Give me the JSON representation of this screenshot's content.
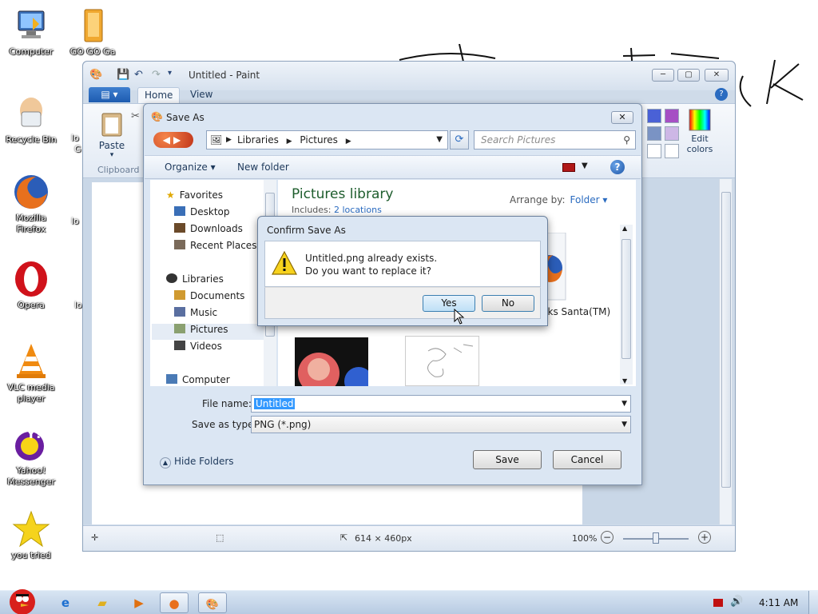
{
  "desktop": {
    "icons": [
      {
        "label": "Computer"
      },
      {
        "label": "GO GO Ga"
      },
      {
        "label": "Recycle Bin"
      },
      {
        "label": "Mozilla Firefox"
      },
      {
        "label": "Opera"
      },
      {
        "label": "VLC media player"
      },
      {
        "label": "Yahoo! Messenger"
      },
      {
        "label": "you tried"
      }
    ],
    "partial_labels": [
      "lo",
      "G",
      "lo",
      "lo"
    ]
  },
  "paint": {
    "title": "Untitled - Paint",
    "file_tab": "▤ ▾",
    "tabs": [
      "Home",
      "View"
    ],
    "paste_label": "Paste",
    "clipboard_label": "Clipboard",
    "edit_colors_label": "Edit colors",
    "status": {
      "dimensions": "614 × 460px",
      "zoom": "100%"
    },
    "colors": [
      "#4a61d6",
      "#a64fc4",
      "#7a93c4",
      "#cdb7e6",
      "#ffffff",
      "#ffffff"
    ]
  },
  "save_as": {
    "title": "Save As",
    "address": [
      "Libraries",
      "Pictures"
    ],
    "search_placeholder": "Search Pictures",
    "toolbar": {
      "organize": "Organize ▾",
      "new_folder": "New folder"
    },
    "nav": {
      "favorites": "Favorites",
      "desktop": "Desktop",
      "downloads": "Downloads",
      "recent_places": "Recent Places",
      "libraries": "Libraries",
      "documents": "Documents",
      "music": "Music",
      "pictures": "Pictures",
      "videos": "Videos",
      "computer": "Computer"
    },
    "library_title": "Pictures library",
    "includes_label": "Includes:",
    "includes_value": "2 locations",
    "arrange_label": "Arrange by:",
    "arrange_value": "Folder ▾",
    "file_label": "D Tracks Santa(TM)",
    "file_name_label": "File name:",
    "file_name_value": "Untitled",
    "save_type_label": "Save as type:",
    "save_type_value": "PNG (*.png)",
    "hide_folders": "Hide Folders",
    "save_button": "Save",
    "cancel_button": "Cancel"
  },
  "confirm": {
    "title": "Confirm Save As",
    "line1": "Untitled.png already exists.",
    "line2": "Do you want to replace it?",
    "yes": "Yes",
    "no": "No"
  },
  "taskbar": {
    "clock": "4:11 AM"
  }
}
